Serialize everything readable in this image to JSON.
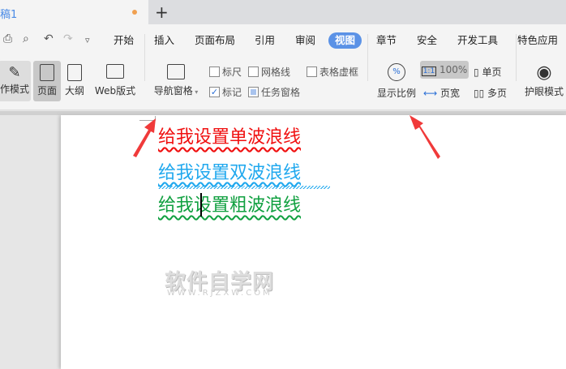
{
  "tab": {
    "title": "稿1",
    "new_tab": "+"
  },
  "quick_access": [
    "print-icon",
    "print-preview-icon",
    "undo-icon",
    "redo-icon",
    "more-icon"
  ],
  "menu": [
    "开始",
    "插入",
    "页面布局",
    "引用",
    "审阅",
    "视图",
    "章节",
    "安全",
    "开发工具",
    "特色应用"
  ],
  "active_menu": "视图",
  "toolbar": {
    "write_mode": "作模式",
    "page": "页面",
    "outline": "大纲",
    "web": "Web版式",
    "nav_pane": "导航窗格",
    "ruler": "标尺",
    "gridlines": "网格线",
    "table_gridlines": "表格虚框",
    "marks": "标记",
    "task_pane": "任务窗格",
    "zoom": "显示比例",
    "zoom_100": "100%",
    "one_to_one": "1:1",
    "page_width": "页宽",
    "single_page": "单页",
    "multi_page": "多页",
    "eye_mode": "护眼模式"
  },
  "checks": {
    "ruler": false,
    "gridlines": false,
    "table_gridlines": false,
    "marks": true,
    "task_pane": true
  },
  "document": {
    "lines": [
      "给我设置单波浪线",
      "给我设置双波浪线",
      "给我设置粗波浪线"
    ],
    "colors": [
      "#f01010",
      "#20a8ee",
      "#10a040"
    ]
  },
  "watermark": {
    "title": "软件自学网",
    "url": "WWW.RJZXW.COM"
  }
}
